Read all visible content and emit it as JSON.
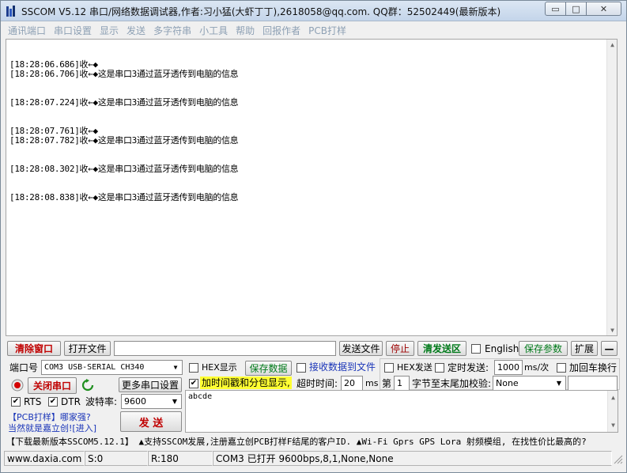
{
  "window": {
    "title": "SSCOM V5.12 串口/网络数据调试器,作者:习小猛(大虾丁丁),2618058@qq.com. QQ群：52502449(最新版本)",
    "minimize_glyph": "▭",
    "maximize_glyph": "□",
    "close_glyph": "✕"
  },
  "menu": [
    {
      "label": "通讯端口"
    },
    {
      "label": "串口设置"
    },
    {
      "label": "显示"
    },
    {
      "label": "发送"
    },
    {
      "label": "多字符串"
    },
    {
      "label": "小工具"
    },
    {
      "label": "帮助"
    },
    {
      "label": "回报作者"
    },
    {
      "label": "PCB打样"
    }
  ],
  "receive": {
    "lines": [
      "",
      "[18:28:06.686]收←◆",
      "[18:28:06.706]收←◆这是串口3通过蓝牙透传到电脑的信息",
      "",
      "",
      "[18:28:07.224]收←◆这是串口3通过蓝牙透传到电脑的信息",
      "",
      "",
      "[18:28:07.761]收←◆",
      "[18:28:07.782]收←◆这是串口3通过蓝牙透传到电脑的信息",
      "",
      "",
      "[18:28:08.302]收←◆这是串口3通过蓝牙透传到电脑的信息",
      "",
      "",
      "[18:28:08.838]收←◆这是串口3通过蓝牙透传到电脑的信息"
    ],
    "scroll_up_glyph": "▲",
    "scroll_down_glyph": "▼"
  },
  "toolbar": {
    "clear_window": "清除窗口",
    "open_file": "打开文件",
    "file_path": "",
    "send_file": "发送文件",
    "stop": "停止",
    "clear_send": "清发送区",
    "english": "English",
    "save_params": "保存参数",
    "expand": "扩展",
    "collapse": "—"
  },
  "port": {
    "port_label": "端口号",
    "port_value": "COM3 USB-SERIAL CH340",
    "close_port": "关闭串口",
    "more_settings": "更多串口设置",
    "rts_label": "RTS",
    "dtr_label": "DTR",
    "baud_label": "波特率:",
    "baud_value": "9600",
    "pcb_link": "【PCB打样】哪家强?",
    "pcb_link2": "当然就是嘉立创![进入]",
    "send_button": "发  送"
  },
  "options": {
    "hex_display": "HEX显示",
    "save_data": "保存数据",
    "recv_to_file": "接收数据到文件",
    "hex_send": "HEX发送",
    "timed_send": "定时发送:",
    "interval_value": "1000",
    "interval_unit": "ms/次",
    "add_crlf": "加回车换行",
    "timestamp": "加时间戳和分包显示,",
    "timeout_label": "超时时间:",
    "timeout_value": "20",
    "timeout_unit": "ms",
    "nth_label": "第",
    "nth_value": "1",
    "checksum_label": "字节至末尾加校验:",
    "checksum_value": "None",
    "extra_value": ""
  },
  "send_area": {
    "text": "abcde"
  },
  "banner": "【下载最新版本SSCOM5.12.1】  ▲支持SSCOM发展,注册嘉立创PCB打样F结尾的客户ID.  ▲Wi-Fi Gprs GPS Lora 射频模组, 在找性价比最高的?",
  "status": {
    "website": "www.daxia.com",
    "sent": "S:0",
    "received": "R:180",
    "port_status": "COM3 已打开  9600bps,8,1,None,None"
  },
  "colors": {
    "menu_text": "#8da0b4",
    "accent_red": "#c00000",
    "accent_green": "#007a1a",
    "timestamp_highlight": "#ffff33"
  }
}
